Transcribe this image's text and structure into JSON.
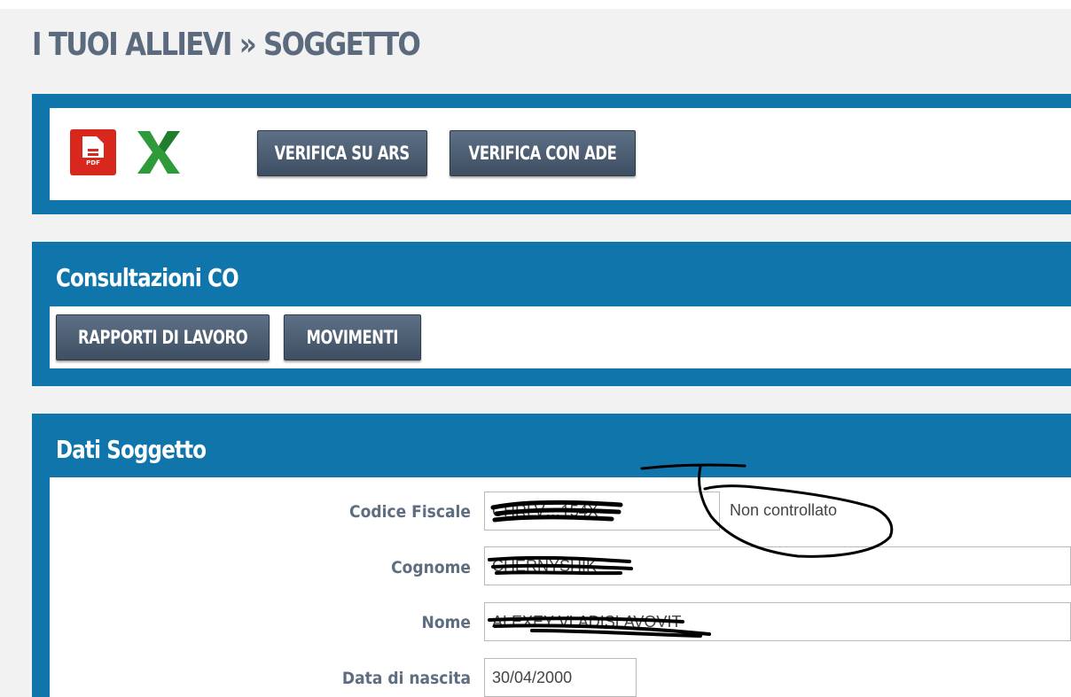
{
  "page": {
    "title": "I TUOI ALLIEVI » SOGGETTO"
  },
  "toolbar": {
    "pdf_icon_text": "PDF",
    "buttons": [
      "VERIFICA SU ARS",
      "VERIFICA CON ADE"
    ]
  },
  "consultazioni": {
    "title": "Consultazioni CO",
    "buttons": [
      "RAPPORTI DI LAVORO",
      "MOVIMENTI"
    ]
  },
  "dati_soggetto": {
    "title": "Dati Soggetto",
    "fields": [
      {
        "label": "Codice Fiscale",
        "value": "CHRLV…154X",
        "status": "Non controllato"
      },
      {
        "label": "Cognome",
        "value": "CHERNYSHIK"
      },
      {
        "label": "Nome",
        "value": "ALEXEY VLADISLAVOVIT"
      },
      {
        "label": "Data di nascita",
        "value": "30/04/2000"
      }
    ]
  },
  "colors": {
    "panel_header": "#0f75aa",
    "button": "#4a5a6e",
    "title_text": "#5b6b7d",
    "pdf_red": "#d8281d",
    "excel_green": "#2f9a3a"
  },
  "icons": [
    "pdf-export-icon",
    "excel-export-icon"
  ]
}
